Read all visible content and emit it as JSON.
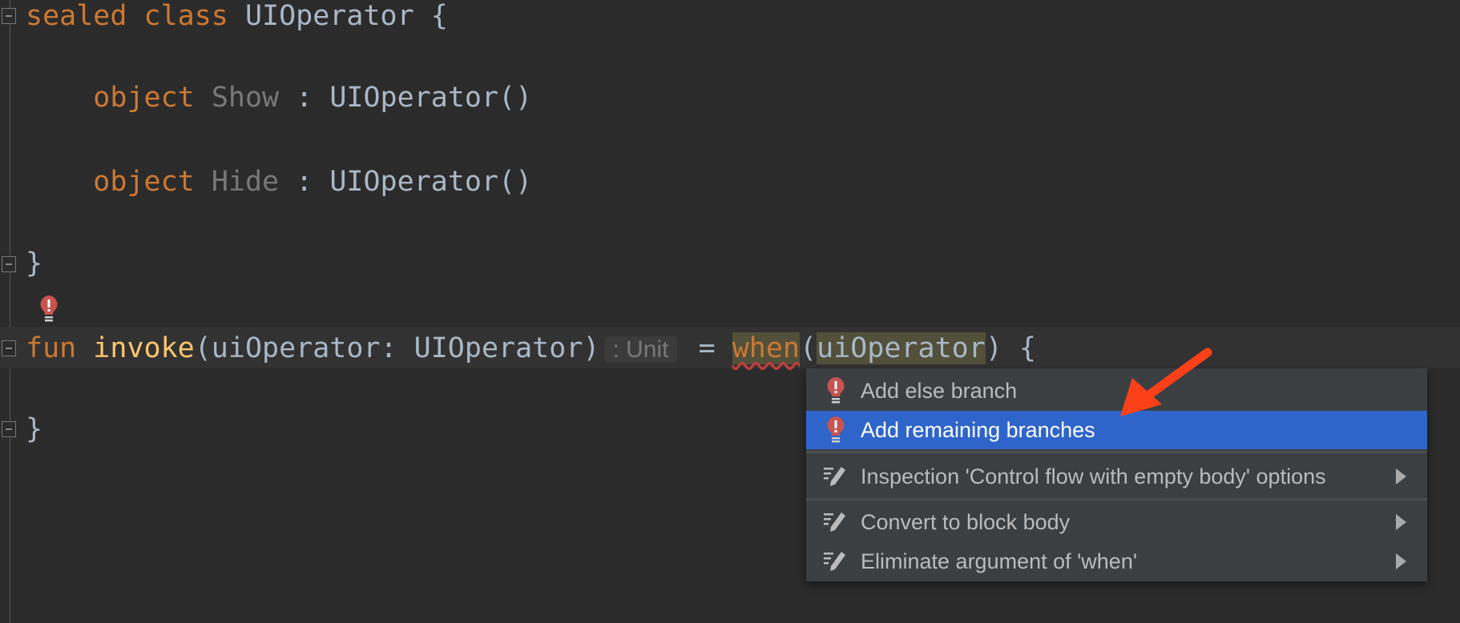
{
  "code": {
    "line1": {
      "kw": "sealed class",
      "name": "UIOperator",
      "rest": " {"
    },
    "line2": {
      "kw": "object",
      "name": "Show",
      "rest": " : UIOperator()"
    },
    "line3": {
      "kw": "object",
      "name": "Hide",
      "rest": " : UIOperator()"
    },
    "line4": "}",
    "line5": {
      "kw": "fun",
      "fn": "invoke",
      "params": "(uiOperator: UIOperator)",
      "hint": ": Unit",
      "eq": " = ",
      "when": "when",
      "open": "(",
      "arg": "uiOperator",
      "close": ") {"
    },
    "line6": "}"
  },
  "menu": {
    "items": [
      {
        "label": "Add else branch",
        "icon": "error-bulb-icon"
      },
      {
        "label": "Add remaining branches",
        "icon": "error-bulb-icon",
        "selected": true
      },
      {
        "label": "Inspection 'Control flow with empty body' options",
        "icon": "edit-icon",
        "submenu": true
      },
      {
        "label": "Convert to block body",
        "icon": "edit-icon",
        "submenu": true
      },
      {
        "label": "Eliminate argument of 'when'",
        "icon": "edit-icon",
        "submenu": true
      }
    ]
  },
  "colors": {
    "keyword": "#cc7832",
    "function": "#ffc66d",
    "text": "#a9b7c6",
    "selection": "#2f65ca",
    "arrow": "#fc4119"
  }
}
